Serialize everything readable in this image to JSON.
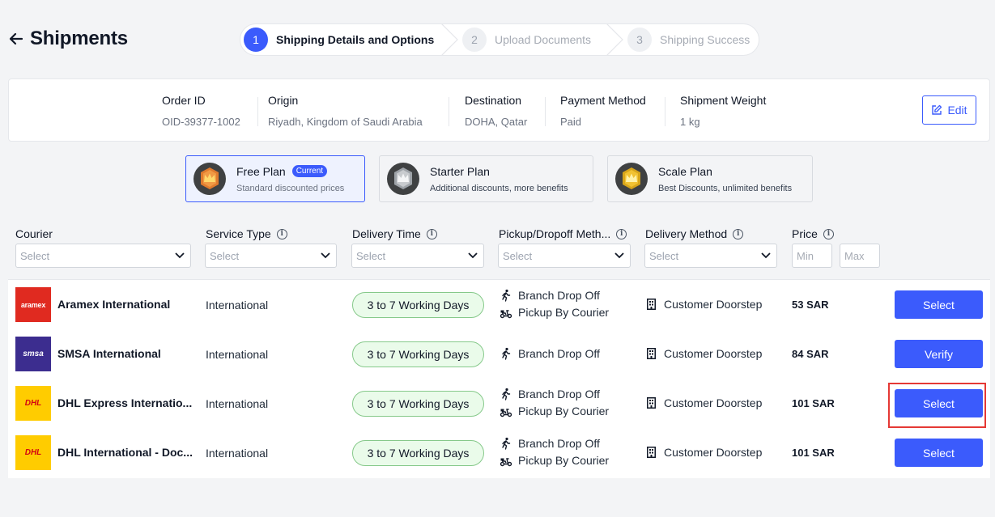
{
  "header": {
    "title": "Shipments"
  },
  "stepper": {
    "steps": [
      {
        "num": "1",
        "label": "Shipping Details and Options"
      },
      {
        "num": "2",
        "label": "Upload Documents"
      },
      {
        "num": "3",
        "label": "Shipping Success"
      }
    ]
  },
  "order": {
    "fields": [
      {
        "label": "Order ID",
        "value": "OID-39377-1002"
      },
      {
        "label": "Origin",
        "value": "Riyadh, Kingdom of Saudi Arabia"
      },
      {
        "label": "Destination",
        "value": "DOHA, Qatar"
      },
      {
        "label": "Payment Method",
        "value": "Paid"
      },
      {
        "label": "Shipment Weight",
        "value": "1 kg"
      }
    ],
    "edit_label": "Edit"
  },
  "plans": [
    {
      "name": "Free Plan",
      "badge": "Current",
      "desc": "Standard discounted prices"
    },
    {
      "name": "Starter Plan",
      "desc": "Additional discounts, more benefits"
    },
    {
      "name": "Scale Plan",
      "desc": "Best Discounts, unlimited benefits"
    }
  ],
  "table": {
    "columns": {
      "courier": "Courier",
      "service_type": "Service Type",
      "delivery_time": "Delivery Time",
      "pickup": "Pickup/Dropoff Meth...",
      "delivery_method": "Delivery Method",
      "price": "Price"
    },
    "filters": {
      "select_placeholder": "Select",
      "min_placeholder": "Min",
      "max_placeholder": "Max"
    },
    "rows": [
      {
        "courier": "Aramex International",
        "logo_text": "aramex",
        "service": "International",
        "delivery_time": "3 to 7 Working Days",
        "pickup": [
          "Branch Drop Off",
          "Pickup By Courier"
        ],
        "delivery_method": "Customer Doorstep",
        "price": "53 SAR",
        "action": "Select"
      },
      {
        "courier": "SMSA International",
        "logo_text": "smsa",
        "service": "International",
        "delivery_time": "3 to 7 Working Days",
        "pickup": [
          "Branch Drop Off"
        ],
        "delivery_method": "Customer Doorstep",
        "price": "84 SAR",
        "action": "Verify"
      },
      {
        "courier": "DHL Express Internatio...",
        "logo_text": "DHL",
        "service": "International",
        "delivery_time": "3 to 7 Working Days",
        "pickup": [
          "Branch Drop Off",
          "Pickup By Courier"
        ],
        "delivery_method": "Customer Doorstep",
        "price": "101 SAR",
        "action": "Select"
      },
      {
        "courier": "DHL International - Doc...",
        "logo_text": "DHL",
        "service": "International",
        "delivery_time": "3 to 7 Working Days",
        "pickup": [
          "Branch Drop Off",
          "Pickup By Courier"
        ],
        "delivery_method": "Customer Doorstep",
        "price": "101 SAR",
        "action": "Select"
      }
    ]
  },
  "colors": {
    "accent": "#3b5bfc",
    "highlight": "#e53935",
    "delivery_pill_bg": "#eafbea",
    "delivery_pill_border": "#86c98a",
    "aramex_red": "#e02a20",
    "smsa_purple": "#3c2d8f",
    "dhl_yellow": "#ffcc00"
  }
}
